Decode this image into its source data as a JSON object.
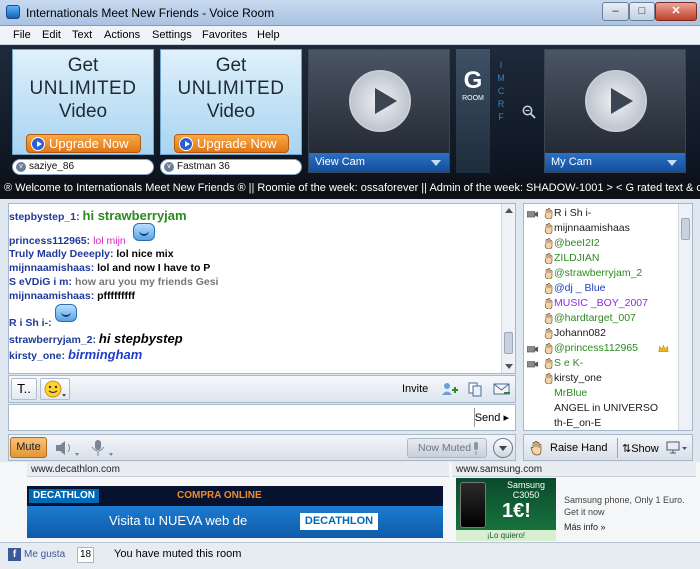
{
  "window": {
    "title": "Internationals Meet New Friends - Voice Room"
  },
  "menu": [
    "File",
    "Edit",
    "Text",
    "Actions",
    "Settings",
    "Favorites",
    "Help"
  ],
  "upgrade_ads": [
    {
      "line1": "Get",
      "line2": "UNLIMITED",
      "line3": "Video",
      "button": "Upgrade Now",
      "user": "saziye_86"
    },
    {
      "line1": "Get",
      "line2": "UNLIMITED",
      "line3": "Video",
      "button": "Upgrade Now",
      "user": "Fastman 36"
    }
  ],
  "cams": {
    "view_cam": "View Cam",
    "my_cam": "My Cam"
  },
  "room_badge": {
    "letter": "G",
    "label": "ROOM",
    "letters": [
      "I",
      "M",
      "C",
      "R",
      "F"
    ]
  },
  "ticker": "® Welcome to Internationals Meet New Friends ® || Roomie of the week: ossaforever || Admin of the week:  SHADOW-1001 > < G rated text & cams > <",
  "chat": [
    {
      "nick": "stepbystep_1:",
      "text": "hi strawberryjam",
      "color": "#2a8a1e"
    },
    {
      "nick": "princess112965:",
      "text": "lol mijn",
      "color": "#e020c8"
    },
    {
      "nick": "Truly Madly Deeeply:",
      "text": "lol nice mix",
      "color": "#000000"
    },
    {
      "nick": "mijnnaamishaas:",
      "text": "lol and now I have to P",
      "color": "#000000"
    },
    {
      "nick": "S eVDiG i m:",
      "text": "how aru you my friends Gesi",
      "color": "#777777"
    },
    {
      "nick": "mijnnaamishaas:",
      "text": "pfffffffff",
      "color": "#000000"
    },
    {
      "nick": "R i Sh i-:",
      "text": "",
      "color": "#000000"
    },
    {
      "nick": "strawberryjam_2:",
      "text": "hi stepbystep",
      "color": "#000000"
    },
    {
      "nick": "kirsty_one:",
      "text": "birmingham",
      "color": "#1f3ec8"
    }
  ],
  "composer": {
    "invite": "Invite",
    "send": "Send ▸",
    "text_tool": "T"
  },
  "audio": {
    "mute": "Mute",
    "now_muted": "Now Muted"
  },
  "users": [
    {
      "name": "R i Sh i-",
      "color": "#1a1a1a",
      "icon": "cam-icon"
    },
    {
      "name": "mijnnaamishaas",
      "color": "#1a1a1a",
      "icon": "hand-icon"
    },
    {
      "name": "@beeI2I2",
      "color": "#2a8a1e",
      "icon": "hand-icon"
    },
    {
      "name": "ZILDJIAN",
      "color": "#2a8a1e",
      "icon": "hand-icon"
    },
    {
      "name": "@strawberryjam_2",
      "color": "#2a8a1e",
      "icon": "hand-icon"
    },
    {
      "name": "@dj _ Blue",
      "color": "#1f3ec8",
      "icon": "hand-icon"
    },
    {
      "name": "MUSIC _BOY_2007",
      "color": "#8a2be2",
      "icon": "hand-icon"
    },
    {
      "name": "@hardtarget_007",
      "color": "#2a8a1e",
      "icon": "hand-icon"
    },
    {
      "name": "Johann082",
      "color": "#1a1a1a",
      "icon": "hand-icon"
    },
    {
      "name": "@princess112965",
      "color": "#2a8a1e",
      "icon": "cam-icon"
    },
    {
      "name": "S e K-",
      "color": "#2a8a1e",
      "icon": "cam-icon"
    },
    {
      "name": "kirsty_one",
      "color": "#1a1a1a",
      "icon": "hand-icon"
    },
    {
      "name": "MrBlue",
      "color": "#2a8a1e",
      "icon": "none"
    },
    {
      "name": "ANGEL in UNIVERSO",
      "color": "#1a1a1a",
      "icon": "none"
    },
    {
      "name": "th-E_on-E",
      "color": "#1a1a1a",
      "icon": "none"
    }
  ],
  "userlist_actions": {
    "raise_hand": "Raise Hand",
    "show": "Show"
  },
  "ads": {
    "decathlon_url": "www.decathlon.com",
    "decathlon_logo": "DECATHLON",
    "decathlon_compra": "COMPRA ONLINE",
    "decathlon_visita": "Visita tu NUEVA web de",
    "samsung_url": "www.samsung.com",
    "samsung_model": "Samsung C3050",
    "samsung_price": "1€!",
    "samsung_cta": "¡Lo quiero!",
    "samsung_text": "Samsung phone, Only 1 Euro. Get it now",
    "samsung_more": "Más info »"
  },
  "status": {
    "fb_like": "Me gusta",
    "fb_count": "18",
    "text": "You have muted this room"
  }
}
